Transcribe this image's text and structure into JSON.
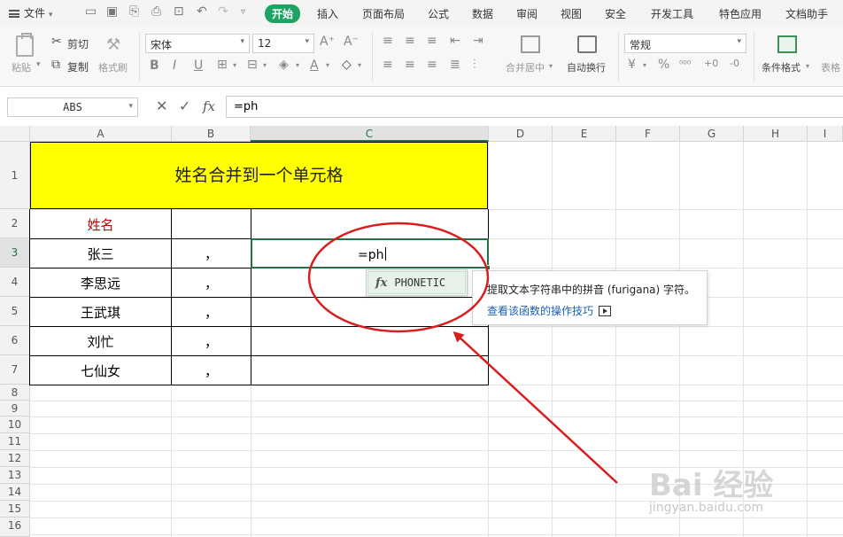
{
  "menubar": {
    "file_label": "文件",
    "tabs": [
      "开始",
      "插入",
      "页面布局",
      "公式",
      "数据",
      "审阅",
      "视图",
      "安全",
      "开发工具",
      "特色应用",
      "文档助手"
    ],
    "active_tab": "开始"
  },
  "ribbon": {
    "paste": "粘贴",
    "cut": "剪切",
    "copy": "复制",
    "format_painter": "格式刷",
    "font_name": "宋体",
    "font_size": "12",
    "merge_center": "合并居中",
    "wrap_text": "自动换行",
    "number_format": "常规",
    "conditional_format": "条件格式",
    "table_style": "表格"
  },
  "formula_bar": {
    "name_box": "ABS",
    "fx": "fx",
    "formula": "=ph"
  },
  "sheet": {
    "columns": [
      "A",
      "B",
      "C",
      "D",
      "E",
      "F",
      "G",
      "H",
      "I"
    ],
    "rows": [
      "1",
      "2",
      "3",
      "4",
      "5",
      "6",
      "7",
      "8",
      "9",
      "10",
      "11",
      "12",
      "13",
      "14",
      "15",
      "16"
    ],
    "title": "姓名合并到一个单元格",
    "header_name": "姓名",
    "names": [
      "张三",
      "李思远",
      "王武琪",
      "刘忙",
      "七仙女"
    ],
    "separators": [
      "，",
      "，",
      "，",
      "，",
      "，"
    ],
    "editing_text": "=ph"
  },
  "autocomplete": {
    "icon": "fx",
    "function": "PHONETIC",
    "description": "提取文本字符串中的拼音 (furigana) 字符。",
    "link": "查看该函数的操作技巧"
  },
  "watermark": {
    "logo": "Bai 经验",
    "url": "jingyan.baidu.com"
  },
  "colors": {
    "accent": "#217346",
    "tab_active": "#1ea362",
    "title_fill": "#ffff00",
    "annotation": "#d81e1e",
    "header_text": "#c00000"
  }
}
